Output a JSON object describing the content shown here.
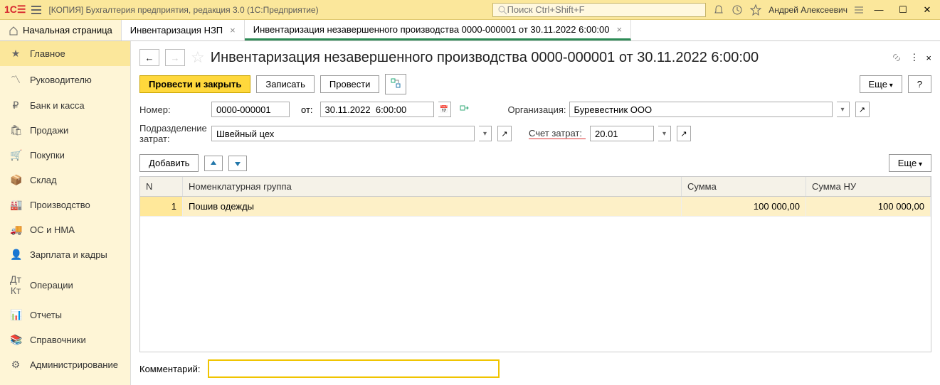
{
  "app": {
    "title": "[КОПИЯ] Бухгалтерия предприятия, редакция 3.0  (1С:Предприятие)",
    "search_placeholder": "Поиск Ctrl+Shift+F",
    "user": "Андрей Алексеевич"
  },
  "tabs": {
    "home": "Начальная страница",
    "t1": "Инвентаризация НЗП",
    "t2": "Инвентаризация незавершенного производства 0000-000001 от 30.11.2022 6:00:00"
  },
  "sidebar": {
    "items": [
      "Главное",
      "Руководителю",
      "Банк и касса",
      "Продажи",
      "Покупки",
      "Склад",
      "Производство",
      "ОС и НМА",
      "Зарплата и кадры",
      "Операции",
      "Отчеты",
      "Справочники",
      "Администрирование"
    ]
  },
  "doc": {
    "title": "Инвентаризация незавершенного производства 0000-000001 от 30.11.2022 6:00:00"
  },
  "toolbar": {
    "post_close": "Провести и закрыть",
    "record": "Записать",
    "post": "Провести",
    "more": "Еще",
    "help": "?",
    "add": "Добавить"
  },
  "form": {
    "number_label": "Номер:",
    "number": "0000-000001",
    "from_label": "от:",
    "date": "30.11.2022  6:00:00",
    "org_label": "Организация:",
    "org": "Буревестник ООО",
    "dept_label": "Подразделение затрат:",
    "dept": "Швейный цех",
    "acct_label": "Счет затрат:",
    "acct": "20.01",
    "comment_label": "Комментарий:",
    "comment": ""
  },
  "table": {
    "headers": {
      "n": "N",
      "name": "Номенклатурная группа",
      "sum": "Сумма",
      "sum_nu": "Сумма НУ"
    },
    "rows": [
      {
        "n": "1",
        "name": "Пошив одежды",
        "sum": "100 000,00",
        "sum_nu": "100 000,00"
      }
    ]
  }
}
